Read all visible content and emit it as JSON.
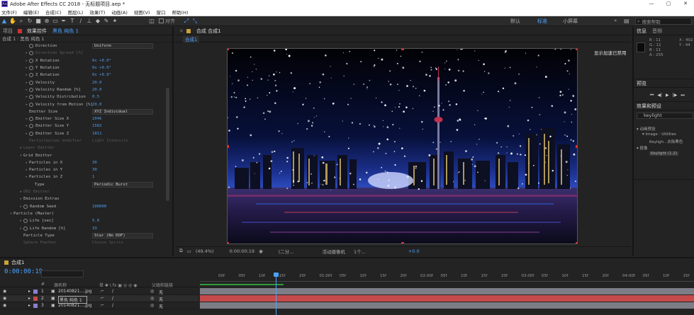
{
  "titlebar": {
    "title": "Adobe After Effects CC 2018 - 无标题项目.aep *",
    "logo": "Ae",
    "controls": [
      "—",
      "▢",
      "✕"
    ]
  },
  "menu": [
    "文件(F)",
    "编辑(E)",
    "合成(C)",
    "图层(L)",
    "效果(T)",
    "动画(A)",
    "视图(V)",
    "窗口",
    "帮助(H)"
  ],
  "toolbar": {
    "checkbox_label": "对齐",
    "workspaces": [
      "默认",
      "标准",
      "小屏幕"
    ],
    "more": "»",
    "search_placeholder": "搜索帮助"
  },
  "left_panel": {
    "tabs": [
      "项目",
      "效果控件",
      "黑色 纯色 1"
    ],
    "crumb": "合成 1 · 黑色 纯色 1",
    "rows": [
      {
        "label": "Direction",
        "indent": 36,
        "twirl": "",
        "sw": true,
        "value": "Uniform",
        "dd": true
      },
      {
        "label": "Direction Spread [%]",
        "indent": 36,
        "twirl": "▸",
        "sw": true,
        "value": "",
        "dim": true
      },
      {
        "label": "X Rotation",
        "indent": 36,
        "twirl": "▸",
        "sw": true,
        "value": "0x +0.0°"
      },
      {
        "label": "Y Rotation",
        "indent": 36,
        "twirl": "▸",
        "sw": true,
        "value": "0x +0.0°"
      },
      {
        "label": "Z Rotation",
        "indent": 36,
        "twirl": "▸",
        "sw": true,
        "value": "0x +0.0°"
      },
      {
        "label": "Velocity",
        "indent": 36,
        "twirl": "▸",
        "sw": true,
        "value": "20.0"
      },
      {
        "label": "Velocity Random [%]",
        "indent": 36,
        "twirl": "▸",
        "sw": true,
        "value": "20.0"
      },
      {
        "label": "Velocity Distribution",
        "indent": 36,
        "twirl": "▸",
        "sw": true,
        "value": "0.5"
      },
      {
        "label": "Velocity from Motion [%]",
        "indent": 36,
        "twirl": "▸",
        "sw": true,
        "value": "20.0"
      },
      {
        "label": "Emitter Size",
        "indent": 36,
        "twirl": "",
        "sw": false,
        "value": "XYZ Individual",
        "dd": true
      },
      {
        "label": "Emitter Size X",
        "indent": 36,
        "twirl": "▸",
        "sw": true,
        "value": "2046"
      },
      {
        "label": "Emitter Size Y",
        "indent": 36,
        "twirl": "▸",
        "sw": true,
        "value": "1582"
      },
      {
        "label": "Emitter Size Z",
        "indent": 36,
        "twirl": "▸",
        "sw": true,
        "value": "1811"
      },
      {
        "label": "Particles/sec modifier",
        "indent": 36,
        "twirl": "",
        "sw": false,
        "value": "Light Intensity",
        "dim": true
      },
      {
        "label": "Layer Emitter",
        "indent": 28,
        "twirl": "▸",
        "sw": false,
        "value": "",
        "dim": true
      },
      {
        "label": "Grid Emitter",
        "indent": 28,
        "twirl": "▾",
        "sw": false,
        "value": ""
      },
      {
        "label": "Particles in X",
        "indent": 36,
        "twirl": "▸",
        "sw": false,
        "value": "30"
      },
      {
        "label": "Particles in Y",
        "indent": 36,
        "twirl": "▸",
        "sw": false,
        "value": "30"
      },
      {
        "label": "Particles in Z",
        "indent": 36,
        "twirl": "▸",
        "sw": false,
        "value": "1"
      },
      {
        "label": "Type",
        "indent": 44,
        "twirl": "",
        "sw": false,
        "value": "Periodic Burst",
        "dd": true
      },
      {
        "label": "OBJ Emitter",
        "indent": 28,
        "twirl": "▸",
        "sw": false,
        "value": "",
        "dim": true
      },
      {
        "label": "Emission Extras",
        "indent": 28,
        "twirl": "▸",
        "sw": false,
        "value": ""
      },
      {
        "label": "Random Seed",
        "indent": 28,
        "twirl": "▸",
        "sw": true,
        "value": "100000"
      },
      {
        "label": "Particle (Master)",
        "indent": 14,
        "twirl": "▾",
        "sw": false,
        "value": ""
      },
      {
        "label": "Life [sec]",
        "indent": 28,
        "twirl": "▸",
        "sw": true,
        "value": "5.0"
      },
      {
        "label": "Life Random [%]",
        "indent": 28,
        "twirl": "▸",
        "sw": true,
        "value": "33"
      },
      {
        "label": "Particle Type",
        "indent": 28,
        "twirl": "",
        "sw": false,
        "value": "Star (No DOF)",
        "dd": true
      },
      {
        "label": "Sphere Feather",
        "indent": 28,
        "twirl": "",
        "sw": false,
        "value": "Choose Sprite",
        "dim": true
      }
    ]
  },
  "comp_panel": {
    "tab": "合成 合成1",
    "subtab": "合成1",
    "overlay_note": "显示加速已禁用",
    "bottom": {
      "zoom": "(49.4%)",
      "time": "0:00:00:19",
      "resolution": "(二分...",
      "camera": "活动摄像机",
      "views": "1个...",
      "exposure": "+0.0"
    }
  },
  "right_panel": {
    "info_tabs": [
      "信息",
      "音频"
    ],
    "rgba": [
      "R : 11",
      "G : 11",
      "B : 11",
      "A : 255"
    ],
    "xy": [
      "X : 402",
      "Y : 44"
    ],
    "preview_title": "预览",
    "effects_title": "效果和预设",
    "search_value": "keylight",
    "tree": [
      "▾ 动画预设",
      "▾ Image - Utilities",
      "Keyligh...去除黑色",
      "▾ 抠像",
      "Keylight (1.2)"
    ]
  },
  "timeline": {
    "tab": "合成1",
    "timecode": "0:00:00:19",
    "columns": [
      "#",
      "源名称",
      "单 ✱ \\ fx ▣ ◎ ◎ ◉",
      "父级和链接"
    ],
    "layers": [
      {
        "num": "1",
        "name": "20140821....jpg",
        "parent": "无"
      },
      {
        "num": "2",
        "name": "黑色 纯色 1",
        "parent": "无"
      },
      {
        "num": "3",
        "name": "20140821....jpg",
        "parent": "无"
      }
    ],
    "ruler": [
      "00f",
      "05f",
      "10f",
      "15f",
      "20f",
      "01:00f",
      "05f",
      "10f",
      "15f",
      "20f",
      "02:00f",
      "05f",
      "10f",
      "15f",
      "20f",
      "03:00f",
      "05f",
      "10f",
      "15f",
      "20f",
      "04:00f",
      "05f",
      "10f",
      "15f"
    ]
  },
  "colors": {
    "accent": "#4aa3ff",
    "layer_red": "#c64a4a",
    "layer_gray": "#7d7d86",
    "panel": "#232323"
  }
}
